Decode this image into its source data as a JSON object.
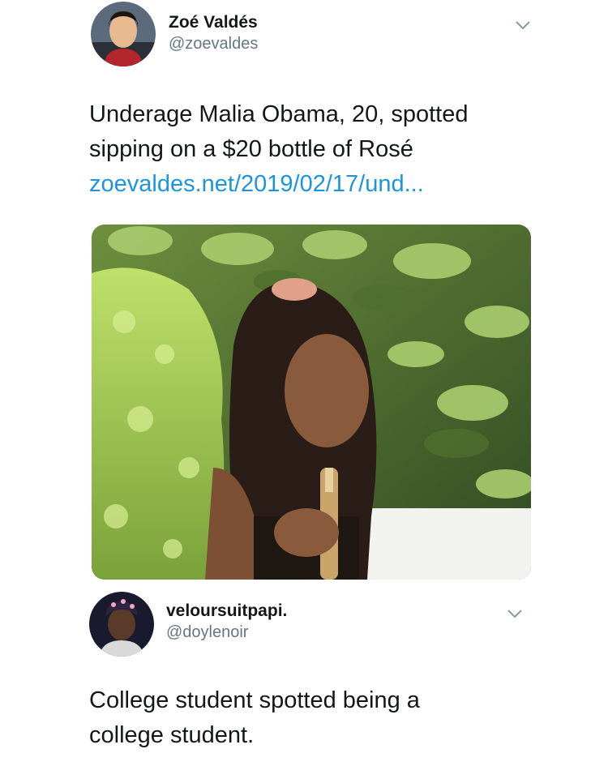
{
  "tweet1": {
    "name": "Zoé Valdés",
    "handle": "@zoevaldes",
    "text_line1": "Underage Malia Obama, 20, spotted",
    "text_line2": "sipping on a $20 bottle of Rosé",
    "link": "zoevaldes.net/2019/02/17/und...",
    "menu_icon": "chevron-down-icon"
  },
  "tweet2": {
    "name": "veloursuitpapi.",
    "handle": "@doylenoir",
    "text_line1": "College student spotted being a",
    "text_line2": "college student.",
    "menu_icon": "chevron-down-icon"
  },
  "colors": {
    "text": "#14171a",
    "secondary": "#657786",
    "link": "#1b95e0"
  }
}
